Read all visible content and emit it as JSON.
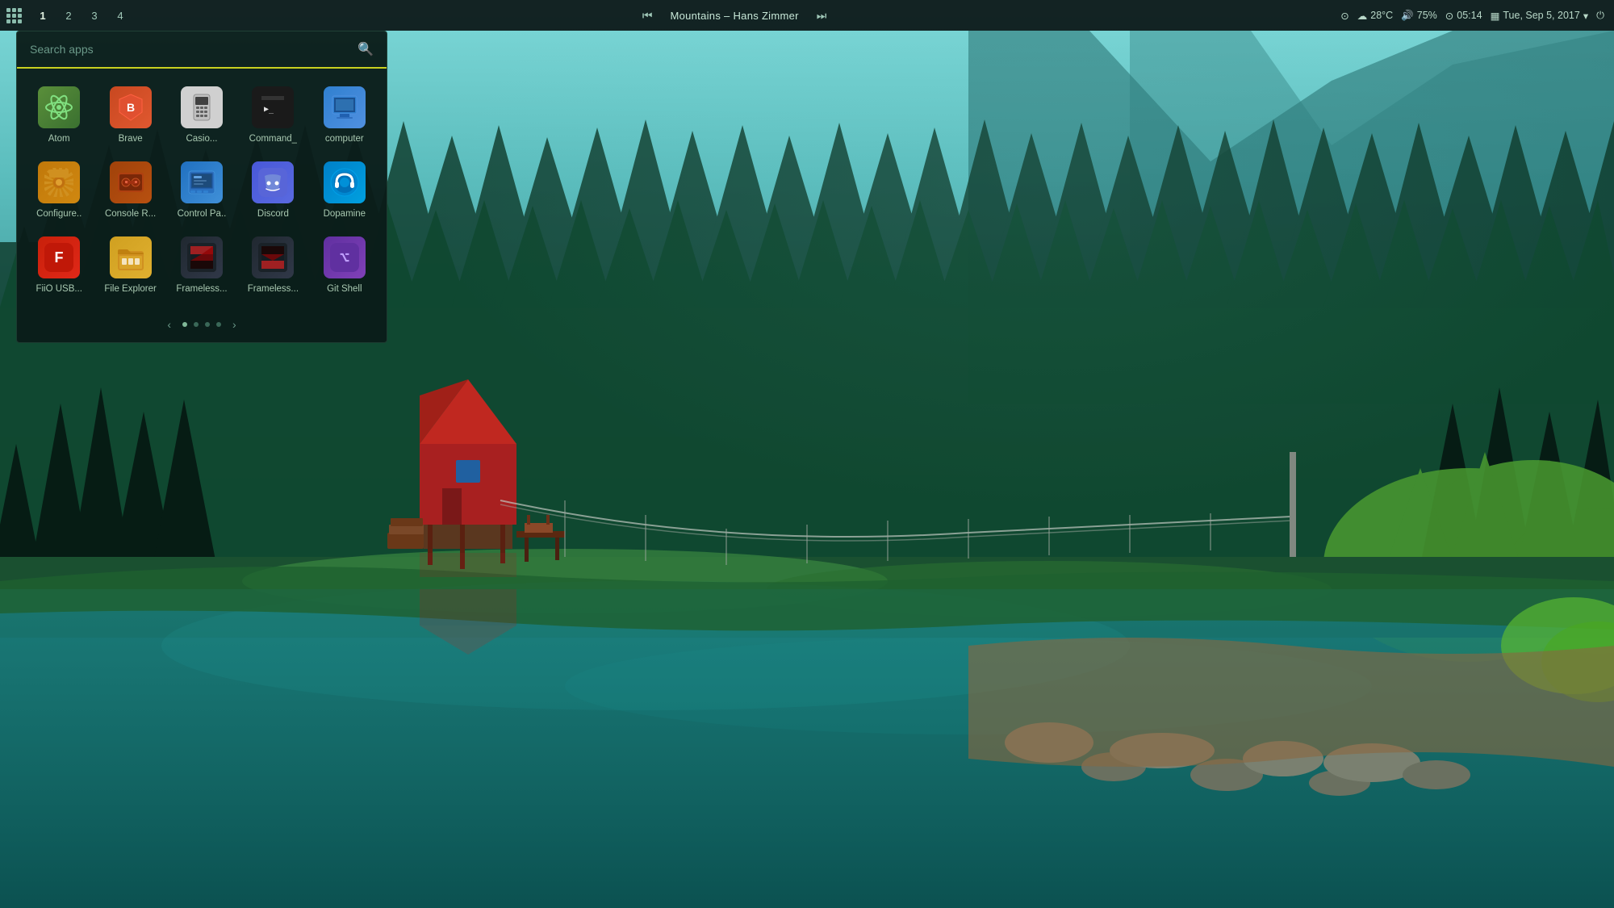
{
  "taskbar": {
    "workspaces": [
      "1",
      "2",
      "3",
      "4"
    ],
    "active_workspace": "1",
    "media": {
      "prev_label": "⏮",
      "next_label": "⏭",
      "song": "Mountains – Hans Zimmer"
    },
    "system": {
      "network_icon": "📶",
      "weather_icon": "🌤",
      "temp": "28°C",
      "volume_icon": "🔊",
      "volume": "75%",
      "clock_icon": "🕐",
      "time": "05:14",
      "calendar_icon": "📅",
      "date": "Tue, Sep 5, 2017",
      "power_icon": "⏻"
    }
  },
  "launcher": {
    "search_placeholder": "Search apps",
    "apps": [
      {
        "id": "atom",
        "label": "Atom",
        "icon_class": "icon-atom",
        "symbol": "⚛"
      },
      {
        "id": "brave",
        "label": "Brave",
        "icon_class": "icon-brave",
        "symbol": "🦁"
      },
      {
        "id": "casio",
        "label": "Casio...",
        "icon_class": "icon-casio",
        "symbol": "📱"
      },
      {
        "id": "command",
        "label": "Command_",
        "icon_class": "icon-command",
        "symbol": "▶"
      },
      {
        "id": "computer",
        "label": "computer",
        "icon_class": "icon-computer",
        "symbol": "💻"
      },
      {
        "id": "configure",
        "label": "Configure..",
        "icon_class": "icon-configure",
        "symbol": "⚙"
      },
      {
        "id": "console",
        "label": "Console R...",
        "icon_class": "icon-console",
        "symbol": "🎮"
      },
      {
        "id": "control",
        "label": "Control Pa..",
        "icon_class": "icon-control",
        "symbol": "🖥"
      },
      {
        "id": "discord",
        "label": "Discord",
        "icon_class": "icon-discord",
        "symbol": "#"
      },
      {
        "id": "dopamine",
        "label": "Dopamine",
        "icon_class": "icon-dopamine",
        "symbol": "🎧"
      },
      {
        "id": "fiio",
        "label": "FiiO USB...",
        "icon_class": "icon-fiio",
        "symbol": "F"
      },
      {
        "id": "fileexp",
        "label": "File Explorer",
        "icon_class": "icon-fileexp",
        "symbol": "📁"
      },
      {
        "id": "frameless1",
        "label": "Frameless...",
        "icon_class": "icon-frameless1",
        "symbol": "▦"
      },
      {
        "id": "frameless2",
        "label": "Frameless...",
        "icon_class": "icon-frameless2",
        "symbol": "▦"
      },
      {
        "id": "gitshell",
        "label": "Git Shell",
        "icon_class": "icon-gitshell",
        "symbol": ">"
      }
    ],
    "pagination": {
      "prev_label": "‹",
      "next_label": "›",
      "dots": [
        {
          "active": true
        },
        {
          "active": false
        },
        {
          "active": false
        },
        {
          "active": false
        }
      ]
    }
  }
}
